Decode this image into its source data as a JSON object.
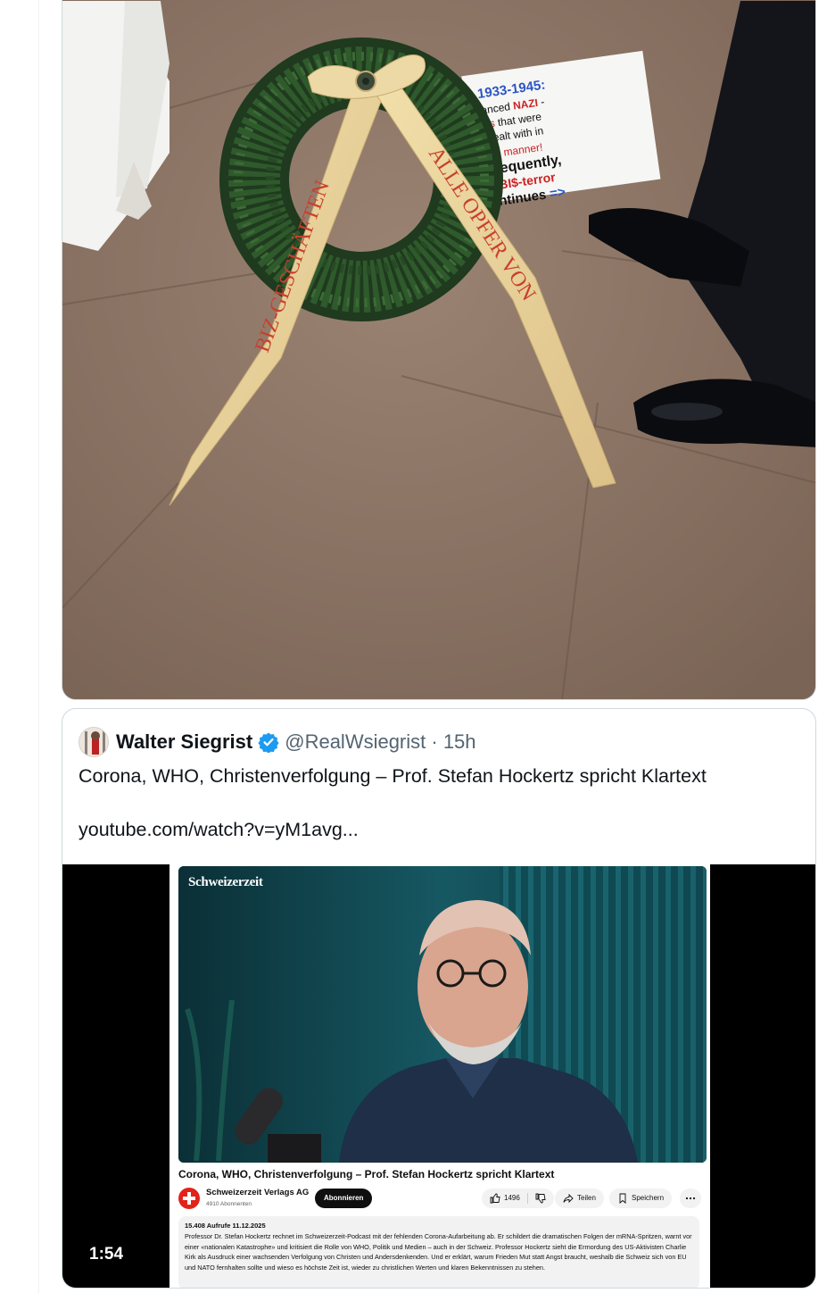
{
  "photo": {
    "wreath_ribbon_left": "BIZ-GESCHÄFTEN",
    "wreath_ribbon_right": "ALLE OPFER VON",
    "sign_lines": [
      "1933-1945:",
      "...nanced NAZI -",
      "...mes that were",
      "...R dealt with in",
      "...tral manner!",
      "...nsequently,",
      "...e BI$-terror",
      "...ontinues =>"
    ]
  },
  "quote": {
    "name": "Walter Siegrist",
    "handle_time": "@RealWsiegrist · 15h",
    "text": "Corona, WHO, Christenverfolgung – Prof. Stefan Hockertz spricht Klartext",
    "link": "youtube.com/watch?v=yM1avg..."
  },
  "video": {
    "duration": "1:54",
    "brand": "Schweizerzeit",
    "title": "Corona, WHO, Christenverfolgung – Prof. Stefan Hockertz spricht Klartext",
    "channel": "Schweizerzeit Verlags AG",
    "subscribers": "4910 Abonnenten",
    "subscribe_label": "Abonnieren",
    "likes": "1496",
    "share_label": "Teilen",
    "save_label": "Speichern",
    "meta": "15.408 Aufrufe  11.12.2025",
    "description": "Professor Dr. Stefan Hockertz rechnet im Schweizerzeit-Podcast mit der fehlenden Corona-Aufarbeitung ab. Er schildert die dramatischen Folgen der mRNA-Spritzen, warnt vor einer «nationalen Katastrophe» und kritisiert die Rolle von WHO, Politik und Medien – auch in der Schweiz. Professor Hockertz sieht die Ermordung des US-Aktivisten Charlie Kirk als Ausdruck einer wachsenden Verfolgung von Christen und Andersdenkenden. Und er erklärt, warum Frieden Mut statt Angst braucht, weshalb die Schweiz sich von EU und NATO fernhalten sollte und wieso es höchste Zeit ist, wieder zu christlichen Werten und klaren Bekenntnissen zu stehen."
  },
  "colors": {
    "accent": "#1d9bf0",
    "yt_red": "#e2231a"
  }
}
